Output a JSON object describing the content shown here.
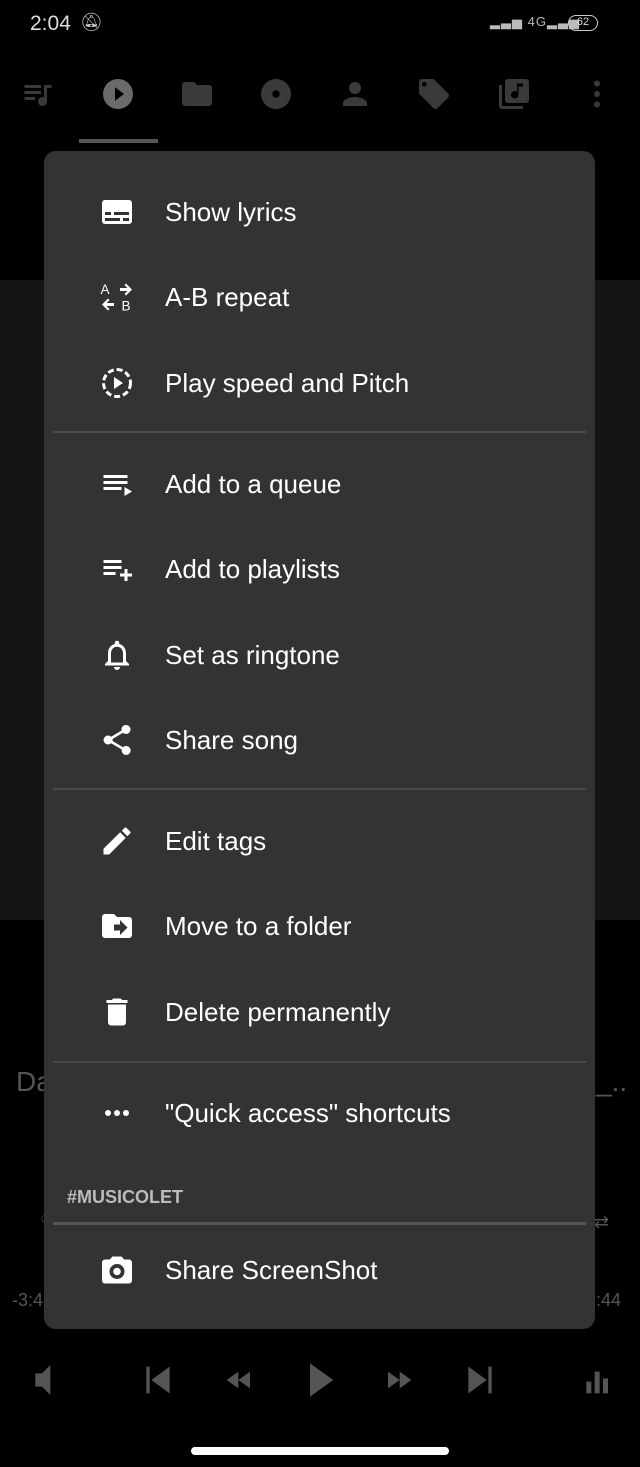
{
  "status_bar": {
    "time": "2:04",
    "signal": "4G",
    "battery": "62",
    "icons": [
      "bell-off-icon",
      "signal-icon",
      "battery-icon"
    ]
  },
  "tabs": [
    {
      "icon": "queue-music-icon"
    },
    {
      "icon": "play-circle-icon",
      "active": true
    },
    {
      "icon": "folder-icon"
    },
    {
      "icon": "album-icon"
    },
    {
      "icon": "artist-icon"
    },
    {
      "icon": "tag-icon"
    },
    {
      "icon": "library-music-icon"
    },
    {
      "icon": "more-vert-icon"
    }
  ],
  "background": {
    "song_title_partial": "Da",
    "song_title_tail": "_..",
    "time_remaining": "-3:4",
    "time_total": ":44"
  },
  "menu": {
    "groups": [
      [
        {
          "label": "Show lyrics",
          "icon": "subtitles-icon"
        },
        {
          "label": "A-B repeat",
          "icon": "ab-repeat-icon"
        },
        {
          "label": "Play speed and Pitch",
          "icon": "play-speed-icon"
        }
      ],
      [
        {
          "label": "Add to a queue",
          "icon": "queue-icon"
        },
        {
          "label": "Add to playlists",
          "icon": "playlist-add-icon"
        },
        {
          "label": "Set as ringtone",
          "icon": "bell-icon"
        },
        {
          "label": "Share song",
          "icon": "share-icon"
        }
      ],
      [
        {
          "label": "Edit tags",
          "icon": "pencil-icon"
        },
        {
          "label": "Move to a folder",
          "icon": "move-folder-icon"
        },
        {
          "label": "Delete permanently",
          "icon": "trash-icon"
        }
      ],
      [
        {
          "label": "\"Quick access\" shortcuts",
          "icon": "more-horiz-icon"
        }
      ]
    ],
    "section_header": "#MUSICOLET",
    "footer_item": {
      "label": "Share ScreenShot",
      "icon": "camera-icon"
    }
  },
  "colors": {
    "menu_bg": "#333333",
    "background": "#000000",
    "text": "#ffffff"
  }
}
